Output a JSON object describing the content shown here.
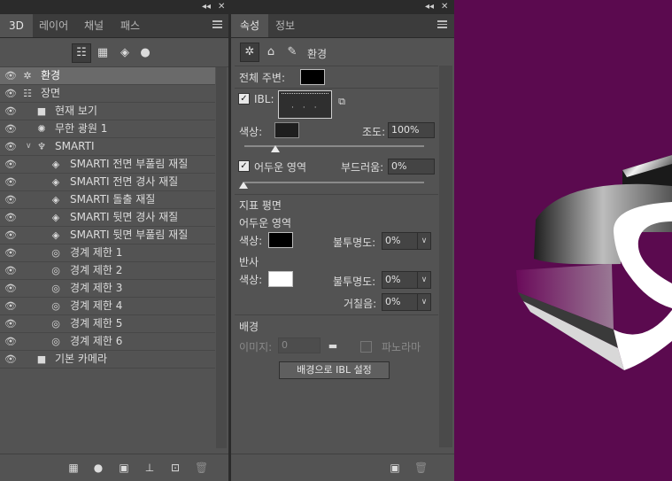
{
  "colors": {
    "canvas_bg": "#5b0a4f",
    "panel_bg": "#535353",
    "selected_row": "#6a6a6a"
  },
  "left_panel": {
    "tabs": [
      {
        "label": "3D",
        "active": true
      },
      {
        "label": "레이어",
        "active": false
      },
      {
        "label": "채널",
        "active": false
      },
      {
        "label": "패스",
        "active": false
      }
    ],
    "filter_icons": [
      "scene-filter-icon",
      "mesh-filter-icon",
      "material-filter-icon",
      "light-filter-icon"
    ],
    "scene_items": [
      {
        "label": "환경",
        "icon": "environment-icon",
        "selected": true
      },
      {
        "label": "장면",
        "icon": "scene-icon"
      },
      {
        "label": "현재 보기",
        "icon": "camera-icon"
      },
      {
        "label": "무한 광원 1",
        "icon": "infinite-light-icon"
      },
      {
        "label": "SMARTI",
        "icon": "mesh-icon",
        "expanded": true
      },
      {
        "label": "SMARTI 전면 부풀림 재질",
        "icon": "material-icon"
      },
      {
        "label": "SMARTI 전면 경사 재질",
        "icon": "material-icon"
      },
      {
        "label": "SMARTI 돌출 재질",
        "icon": "material-icon"
      },
      {
        "label": "SMARTI 뒷면 경사 재질",
        "icon": "material-icon"
      },
      {
        "label": "SMARTI 뒷면 부풀림 재질",
        "icon": "material-icon"
      },
      {
        "label": "경계 제한 1",
        "icon": "constraint-icon"
      },
      {
        "label": "경계 제한 2",
        "icon": "constraint-icon"
      },
      {
        "label": "경계 제한 3",
        "icon": "constraint-icon"
      },
      {
        "label": "경계 제한 4",
        "icon": "constraint-icon"
      },
      {
        "label": "경계 제한 5",
        "icon": "constraint-icon"
      },
      {
        "label": "경계 제한 6",
        "icon": "constraint-icon"
      },
      {
        "label": "기본 카메라",
        "icon": "camera-icon"
      }
    ],
    "bottom_icons": [
      "add-mesh-icon",
      "add-light-icon",
      "render-icon",
      "ground-icon",
      "constraint-add-icon",
      "trash-icon"
    ]
  },
  "right_panel": {
    "tabs": [
      {
        "label": "속성",
        "active": true
      },
      {
        "label": "정보",
        "active": false
      }
    ],
    "mode_title": "환경",
    "global_ambient_label": "전체 주변:",
    "ibl_label": "IBL:",
    "ibl_checked": true,
    "color_label": "색상:",
    "intensity_label": "조도:",
    "intensity_value": "100%",
    "intensity_slider_fraction": 0.15,
    "shadows_label": "어두운 영역",
    "shadows_checked": true,
    "softness_label": "부드러움:",
    "softness_value": "0%",
    "softness_slider_fraction": 0.0,
    "ground_plane_title": "지표 평면",
    "ground_shadows_label": "어두운 영역",
    "ground_color_label": "색상:",
    "opacity_label": "불투명도:",
    "ground_opacity_value": "0%",
    "reflection_title": "반사",
    "reflection_color_label": "색상:",
    "reflection_opacity_value": "0%",
    "roughness_label": "거칠음:",
    "roughness_value": "0%",
    "background_title": "배경",
    "image_label": "이미지:",
    "image_value": "0",
    "panorama_label": "파노라마",
    "set_ibl_button": "배경으로 IBL 설정",
    "bottom_icons": [
      "render-icon",
      "trash-icon"
    ]
  }
}
